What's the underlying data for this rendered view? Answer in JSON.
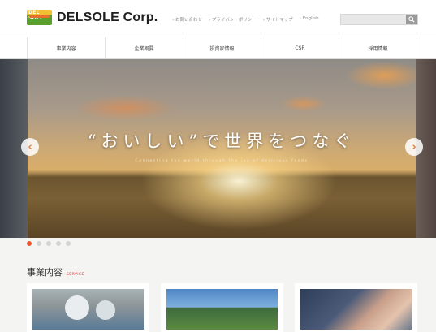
{
  "header": {
    "logo_mark_text": "DEL SOLE",
    "logo_text": "DELSOLE Corp.",
    "utility_links": [
      "› お問い合わせ",
      "› プライバシーポリシー",
      "› サイトマップ",
      "› English"
    ],
    "search": {
      "placeholder": "",
      "button_icon": "search-icon"
    }
  },
  "nav": {
    "items": [
      "事業内容",
      "企業概要",
      "投資家情報",
      "CSR",
      "採用情報"
    ]
  },
  "hero": {
    "title": "“おいしい”で世界をつなぐ",
    "subtitle": "Connecting the world through the joy of delicious foods",
    "prev_icon": "chevron-left-icon",
    "next_icon": "chevron-right-icon",
    "slide_count": 5,
    "active_slide": 1,
    "colors": {
      "accent": "#e45a2c",
      "arrow": "#e07a3a"
    }
  },
  "section": {
    "title": "事業内容",
    "tag": "SERVICE"
  },
  "cards": [
    {
      "image": "food-production-photo"
    },
    {
      "image": "building-photo"
    },
    {
      "image": "handshake-photo"
    }
  ]
}
